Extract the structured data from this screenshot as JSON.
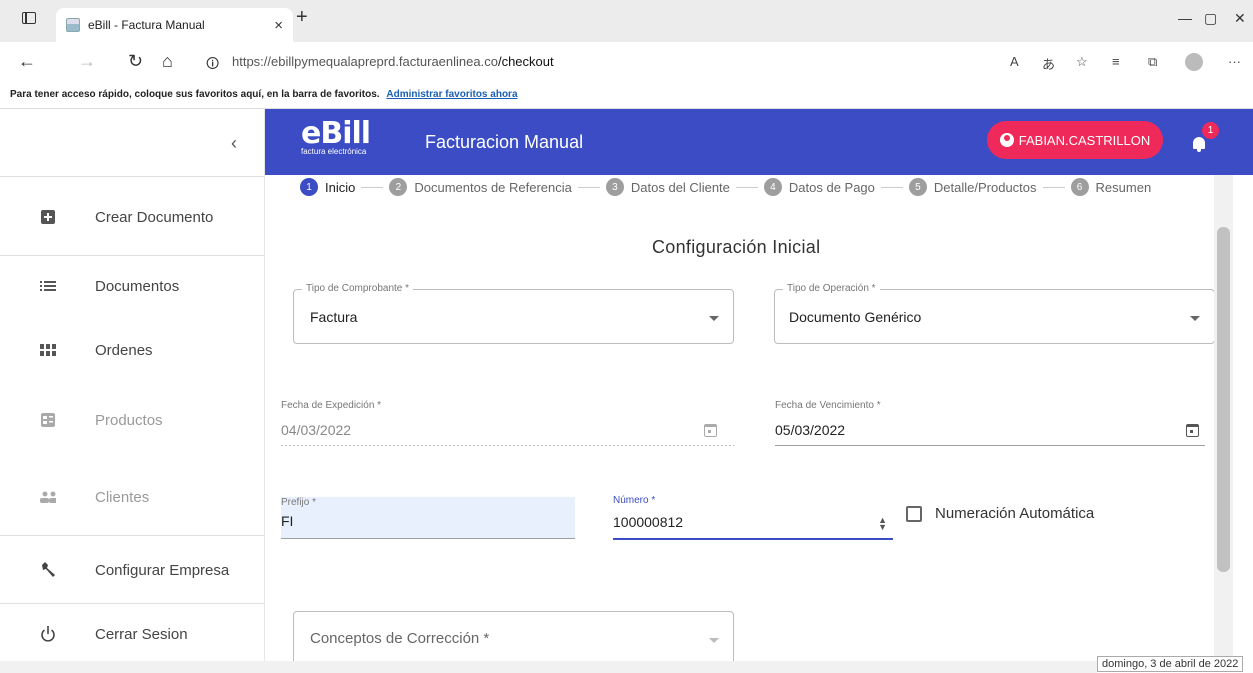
{
  "browser": {
    "tab_title": "eBill - Factura Manual",
    "tab_close": "×",
    "new_tab": "+",
    "url_domain": "https://ebillpymequalapreprd.facturaenlinea.co",
    "url_path": "/checkout",
    "favorites_text": "Para tener acceso rápido, coloque sus favoritos aquí, en la barra de favoritos.",
    "favorites_link": "Administrar favoritos ahora",
    "tooltip_date": "domingo, 3 de abril de 2022"
  },
  "sidebar": {
    "collapse_icon": "‹",
    "items": [
      {
        "label": "Crear Documento",
        "icon": "plus-box-icon"
      },
      {
        "label": "Documentos",
        "icon": "list-icon"
      },
      {
        "label": "Ordenes",
        "icon": "grid-icon"
      },
      {
        "label": "Productos",
        "icon": "product-icon"
      },
      {
        "label": "Clientes",
        "icon": "people-icon"
      },
      {
        "label": "Configurar Empresa",
        "icon": "wrench-icon"
      },
      {
        "label": "Cerrar Sesion",
        "icon": "power-icon"
      }
    ]
  },
  "header": {
    "logo_text": "eBill",
    "logo_sub": "factura electrónica",
    "title": "Facturacion Manual",
    "user": "FABIAN.CASTRILLON",
    "notif_count": "1",
    "color": "#3b4cc4",
    "accent": "#ef2a5a"
  },
  "stepper": [
    {
      "num": "1",
      "label": "Inicio"
    },
    {
      "num": "2",
      "label": "Documentos de Referencia"
    },
    {
      "num": "3",
      "label": "Datos del Cliente"
    },
    {
      "num": "4",
      "label": "Datos de Pago"
    },
    {
      "num": "5",
      "label": "Detalle/Productos"
    },
    {
      "num": "6",
      "label": "Resumen"
    }
  ],
  "form": {
    "section_title": "Configuración Inicial",
    "tipo_comprobante": {
      "label": "Tipo de Comprobante *",
      "value": "Factura"
    },
    "tipo_operacion": {
      "label": "Tipo de Operación *",
      "value": "Documento Genérico"
    },
    "fecha_expedicion": {
      "label": "Fecha de Expedición *",
      "value": "04/03/2022"
    },
    "fecha_vencimiento": {
      "label": "Fecha de Vencimiento *",
      "value": "05/03/2022"
    },
    "prefijo": {
      "label": "Prefijo *",
      "value": "FI"
    },
    "numero": {
      "label": "Número *",
      "value": "100000812"
    },
    "numeracion_auto": "Numeración Automática",
    "conceptos": {
      "placeholder": "Conceptos de Corrección *"
    }
  }
}
